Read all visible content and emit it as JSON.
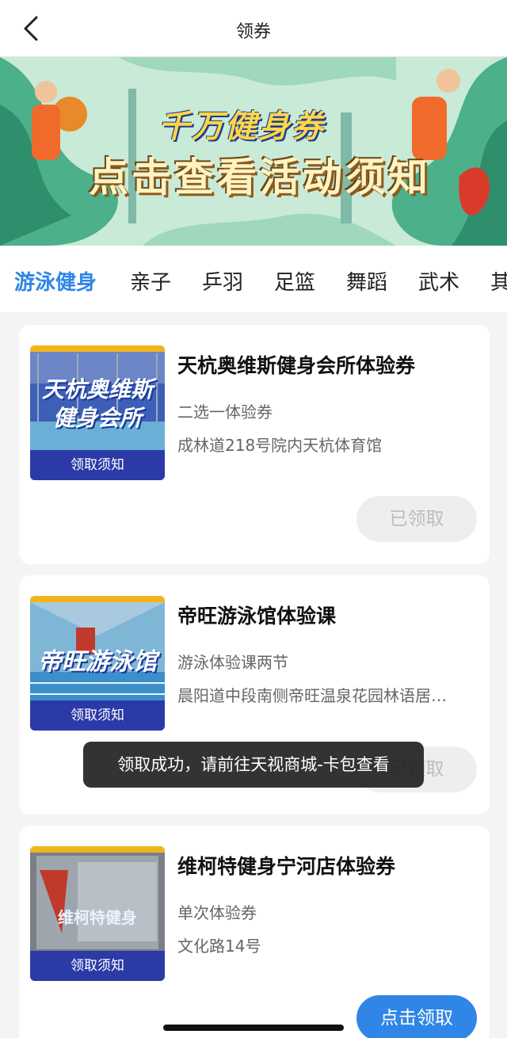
{
  "header": {
    "title": "领券",
    "back_icon": "chevron-left-icon"
  },
  "banner": {
    "line1": "千万健身券",
    "line2": "点击查看活动须知"
  },
  "tabs": [
    "游泳健身",
    "亲子",
    "乒羽",
    "足篮",
    "舞蹈",
    "武术",
    "其"
  ],
  "active_tab": "游泳健身",
  "coupons": [
    {
      "thumb_text": "天杭奥维斯健身会所",
      "thumb_band": "领取须知",
      "name": "天杭奥维斯健身会所体验券",
      "subtitle": "二选一体验券",
      "address": "成林道218号院内天杭体育馆",
      "button": "已领取",
      "claimed": true
    },
    {
      "thumb_text": "帝旺游泳馆",
      "thumb_band": "领取须知",
      "name": "帝旺游泳馆体验课",
      "subtitle": "游泳体验课两节",
      "address": "晨阳道中段南侧帝旺温泉花园林语居…",
      "button": "已领取",
      "claimed": true
    },
    {
      "thumb_text": "维柯特健身",
      "thumb_band": "领取须知",
      "name": "维柯特健身宁河店体验券",
      "subtitle": "单次体验券",
      "address": "文化路14号",
      "button": "点击领取",
      "claimed": false
    }
  ],
  "toast": "领取成功，请前往天视商城-卡包查看",
  "colors": {
    "accent": "#2f86e6",
    "toast_bg": "#222222",
    "thumb_band": "#2b3aa6"
  }
}
